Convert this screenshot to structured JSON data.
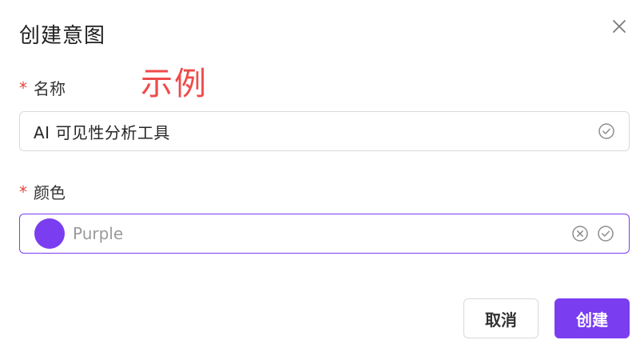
{
  "dialog": {
    "title": "创建意图",
    "example_tag": "示例",
    "close_icon": "close-icon"
  },
  "name_field": {
    "required_mark": "*",
    "label": "名称",
    "value": "AI 可见性分析工具",
    "status_icon": "check-circle-icon"
  },
  "color_field": {
    "required_mark": "*",
    "label": "颜色",
    "value": "Purple",
    "swatch_color": "#7a3df0",
    "clear_icon": "clear-circle-icon",
    "status_icon": "check-circle-icon"
  },
  "actions": {
    "cancel_label": "取消",
    "create_label": "创建",
    "accent_color": "#7a3df0"
  }
}
